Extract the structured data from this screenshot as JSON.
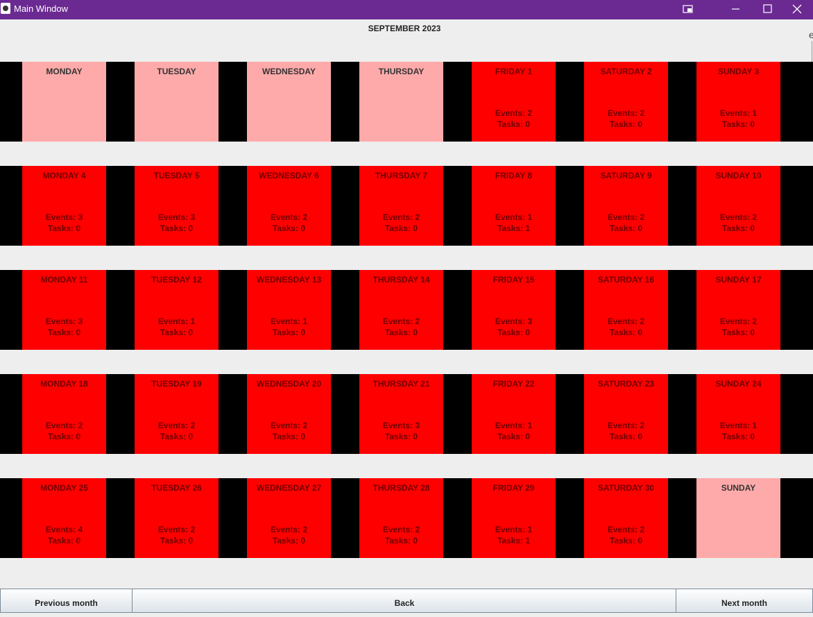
{
  "window": {
    "title": "Main Window"
  },
  "calendar": {
    "month_title": "SEPTEMBER 2023",
    "edge_char": "e",
    "weeks": [
      [
        {
          "label": "MONDAY",
          "empty": true
        },
        {
          "label": "TUESDAY",
          "empty": true
        },
        {
          "label": "WEDNESDAY",
          "empty": true
        },
        {
          "label": "THURSDAY",
          "empty": true
        },
        {
          "label": "FRIDAY 1",
          "events": "Events: 2",
          "tasks": "Tasks: 0"
        },
        {
          "label": "SATURDAY 2",
          "events": "Events: 2",
          "tasks": "Tasks: 0"
        },
        {
          "label": "SUNDAY 3",
          "events": "Events: 1",
          "tasks": "Tasks: 0"
        }
      ],
      [
        {
          "label": "MONDAY 4",
          "events": "Events: 3",
          "tasks": "Tasks: 0"
        },
        {
          "label": "TUESDAY 5",
          "events": "Events: 3",
          "tasks": "Tasks: 0"
        },
        {
          "label": "WEDNESDAY 6",
          "events": "Events: 2",
          "tasks": "Tasks: 0"
        },
        {
          "label": "THURSDAY 7",
          "events": "Events: 2",
          "tasks": "Tasks: 0"
        },
        {
          "label": "FRIDAY 8",
          "events": "Events: 1",
          "tasks": "Tasks: 1"
        },
        {
          "label": "SATURDAY 9",
          "events": "Events: 2",
          "tasks": "Tasks: 0"
        },
        {
          "label": "SUNDAY 10",
          "events": "Events: 2",
          "tasks": "Tasks: 0"
        }
      ],
      [
        {
          "label": "MONDAY 11",
          "events": "Events: 3",
          "tasks": "Tasks: 0"
        },
        {
          "label": "TUESDAY 12",
          "events": "Events: 1",
          "tasks": "Tasks: 0"
        },
        {
          "label": "WEDNESDAY 13",
          "events": "Events: 1",
          "tasks": "Tasks: 0"
        },
        {
          "label": "THURSDAY 14",
          "events": "Events: 2",
          "tasks": "Tasks: 0"
        },
        {
          "label": "FRIDAY 15",
          "events": "Events: 3",
          "tasks": "Tasks: 0"
        },
        {
          "label": "SATURDAY 16",
          "events": "Events: 2",
          "tasks": "Tasks: 0"
        },
        {
          "label": "SUNDAY 17",
          "events": "Events: 2",
          "tasks": "Tasks: 0"
        }
      ],
      [
        {
          "label": "MONDAY 18",
          "events": "Events: 2",
          "tasks": "Tasks: 0"
        },
        {
          "label": "TUESDAY 19",
          "events": "Events: 2",
          "tasks": "Tasks: 0"
        },
        {
          "label": "WEDNESDAY 20",
          "events": "Events: 2",
          "tasks": "Tasks: 0"
        },
        {
          "label": "THURSDAY 21",
          "events": "Events: 3",
          "tasks": "Tasks: 0"
        },
        {
          "label": "FRIDAY 22",
          "events": "Events: 1",
          "tasks": "Tasks: 0"
        },
        {
          "label": "SATURDAY 23",
          "events": "Events: 2",
          "tasks": "Tasks: 0"
        },
        {
          "label": "SUNDAY 24",
          "events": "Events: 1",
          "tasks": "Tasks: 0"
        }
      ],
      [
        {
          "label": "MONDAY 25",
          "events": "Events: 4",
          "tasks": "Tasks: 0"
        },
        {
          "label": "TUESDAY 26",
          "events": "Events: 2",
          "tasks": "Tasks: 0"
        },
        {
          "label": "WEDNESDAY 27",
          "events": "Events: 2",
          "tasks": "Tasks: 0"
        },
        {
          "label": "THURSDAY 28",
          "events": "Events: 2",
          "tasks": "Tasks: 0"
        },
        {
          "label": "FRIDAY 29",
          "events": "Events: 1",
          "tasks": "Tasks: 1"
        },
        {
          "label": "SATURDAY 30",
          "events": "Events: 2",
          "tasks": "Tasks: 0"
        },
        {
          "label": "SUNDAY",
          "empty": true
        }
      ]
    ]
  },
  "nav": {
    "previous_label": "Previous month",
    "back_label": "Back",
    "next_label": "Next month"
  },
  "colors": {
    "titlebar": "#6b2a92",
    "active_day": "#ff0000",
    "empty_day": "#ffaaaa",
    "week_background": "#000000"
  },
  "icons": {
    "titlebar": [
      "app-icon",
      "pip-icon",
      "minimize-icon",
      "maximize-icon",
      "close-icon"
    ]
  }
}
